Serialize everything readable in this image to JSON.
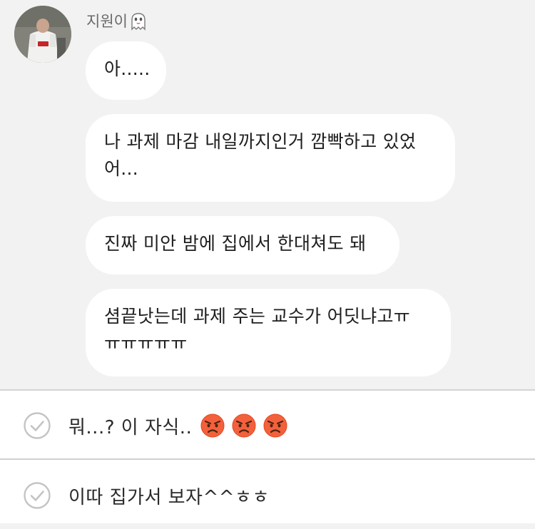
{
  "conversation": {
    "sender": {
      "name": "지원이",
      "name_icon": "ghost-emoji-icon",
      "avatar": "profile-photo"
    },
    "messages": [
      {
        "text": "아....."
      },
      {
        "text": "나 과제 마감 내일까지인거 깜빡하고 있었\n어..."
      },
      {
        "text": "진짜 미안 밤에 집에서 한대쳐도 돼"
      },
      {
        "text": "셤끝낫는데 과제 주는 교수가 어딧냐고ㅠ\nㅠㅠㅠㅠㅠ"
      }
    ]
  },
  "reply_options": [
    {
      "text": "뭐...? 이 자식..",
      "icon": "check-circle-icon",
      "emojis": [
        "angry-face-emoji",
        "angry-face-emoji",
        "angry-face-emoji"
      ]
    },
    {
      "text": "이따 집가서 보자^^ㅎㅎ",
      "icon": "check-circle-icon"
    }
  ],
  "colors": {
    "chat_background": "#f2f2f2",
    "bubble": "#ffffff",
    "divider": "#d4d4d4",
    "check_icon": "#c4c4c4",
    "sender_name": "#6a6a6a"
  }
}
